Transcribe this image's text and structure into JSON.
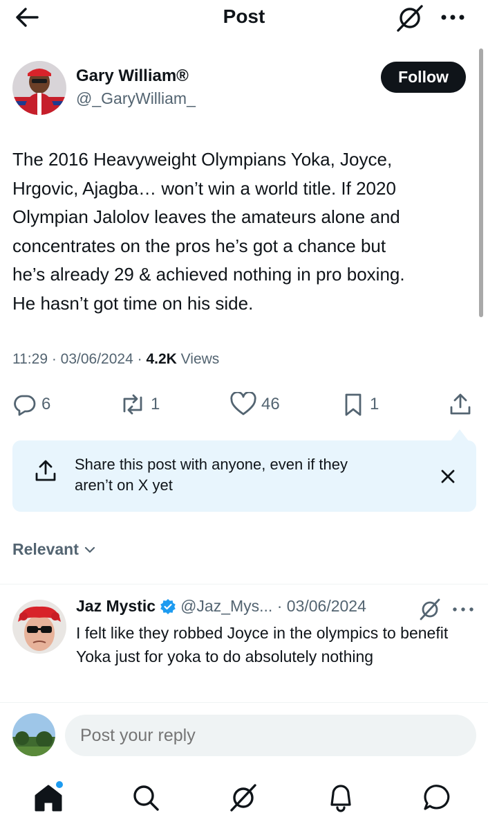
{
  "header": {
    "title": "Post",
    "back_icon": "arrow-left-icon",
    "grok_icon": "grok-icon",
    "more_icon": "more-horizontal-icon"
  },
  "post": {
    "author": {
      "name": "Gary William®",
      "handle": "@_GaryWilliam_"
    },
    "follow_label": "Follow",
    "text": "The 2016 Heavyweight Olympians Yoka, Joyce,\nHrgovic, Ajagba… won’t win a world title. If 2020\nOlympian Jalolov leaves the amateurs alone and\nconcentrates on the pros he’s got a chance but\nhe’s already 29 & achieved nothing in pro boxing.\nHe hasn’t got time on his side.",
    "time": "11:29",
    "date": "03/06/2024",
    "views_count": "4.2K",
    "views_label": "Views",
    "stats": {
      "replies": "6",
      "reposts": "1",
      "likes": "46",
      "bookmarks": "1"
    }
  },
  "share_card": {
    "line1": "Share this post with anyone, even if they",
    "line2": "aren’t on X yet"
  },
  "sort": {
    "label": "Relevant"
  },
  "reply": {
    "name": "Jaz Mystic",
    "handle": "@Jaz_Mys...",
    "date": "03/06/2024",
    "text": "I felt like they robbed Joyce in the olympics to benefit Yoka just for yoka to do absolutely nothing"
  },
  "compose": {
    "placeholder": "Post your reply"
  },
  "colors": {
    "text": "#0f1419",
    "muted": "#536471",
    "accent": "#1d9bf0",
    "card_bg": "#e8f5fd"
  }
}
